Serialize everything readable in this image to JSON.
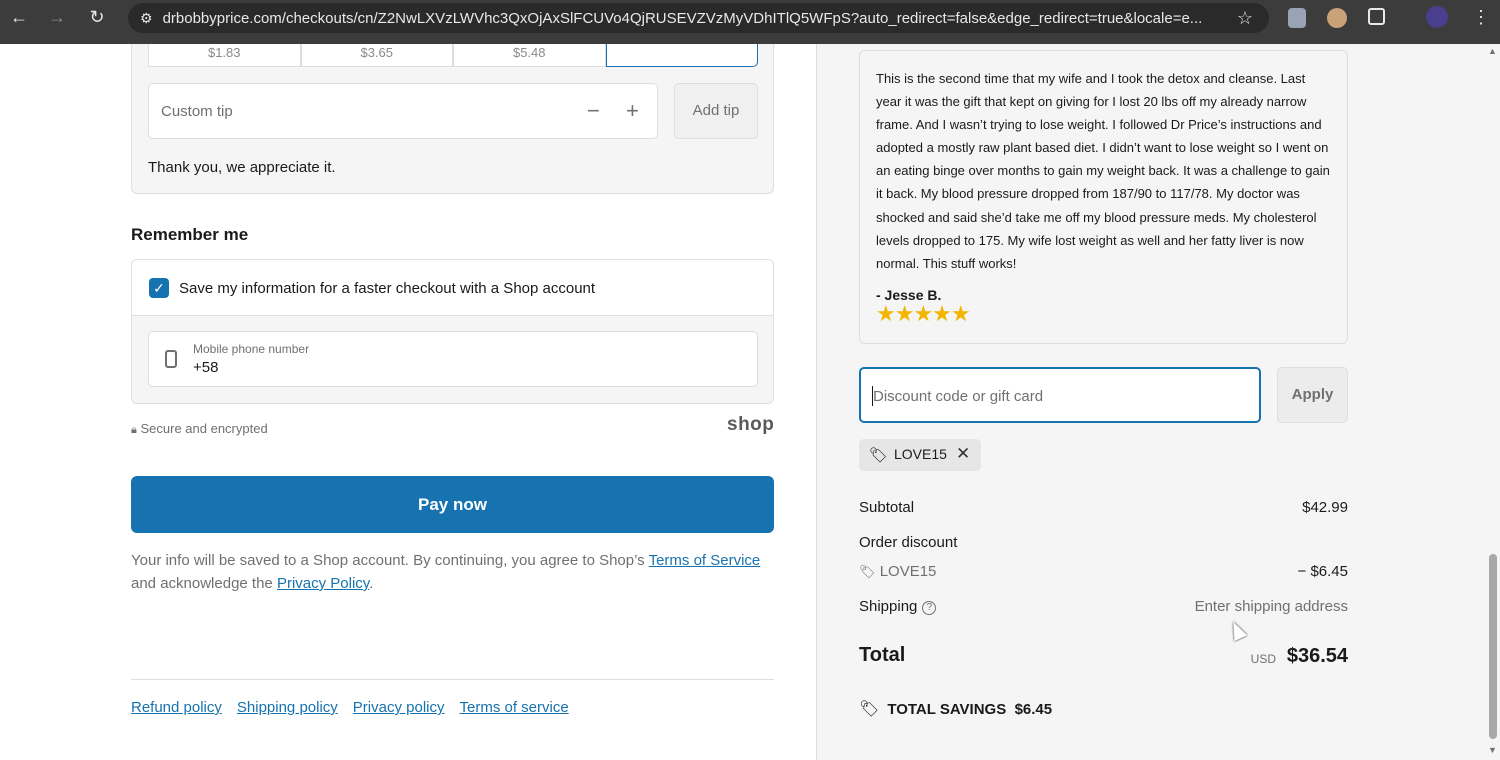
{
  "browser": {
    "url": "drbobbyprice.com/checkouts/cn/Z2NwLXVzLWVhc3QxOjAxSlFCUVo4QjRUSEVZVzMyVDhITlQ5WFpS?auto_redirect=false&edge_redirect=true&locale=e..."
  },
  "tip": {
    "options": [
      "$1.83",
      "$3.65",
      "$5.48",
      ""
    ],
    "custom_placeholder": "Custom tip",
    "minus": "−",
    "plus": "+",
    "add_label": "Add tip",
    "thanks": "Thank you, we appreciate it."
  },
  "remember": {
    "heading": "Remember me",
    "checkbox_label": "Save my information for a faster checkout with a Shop account",
    "phone_label": "Mobile phone number",
    "phone_value": "+58",
    "secure": "Secure and encrypted",
    "shop_logo": "shop"
  },
  "pay": {
    "button": "Pay now",
    "legal_1": "Your info will be saved to a Shop account. By continuing, you agree to Shop’s ",
    "terms_link": "Terms of Service",
    "legal_2": "and acknowledge the ",
    "privacy_link": "Privacy Policy",
    "legal_3": "."
  },
  "footer": {
    "links": [
      "Refund policy",
      "Shipping policy",
      "Privacy policy",
      "Terms of service"
    ]
  },
  "review": {
    "text": "This is the second time that my wife and I took the detox and cleanse. Last year it was the gift that kept on giving for I lost 20 lbs off my already narrow frame. And I wasn’t trying to lose weight. I followed Dr Price’s instructions and adopted a mostly raw plant based diet. I didn’t want to lose weight so I went on an eating binge over months to gain my weight back. It was a challenge to gain it back. My blood pressure dropped from 187/90 to 117/78. My doctor was shocked and said she’d take me off my blood pressure meds. My cholesterol levels dropped to 175. My wife lost weight as well and her fatty liver is now normal. This stuff works!",
    "author": "- Jesse B.",
    "stars": "★★★★★",
    "rating": 5
  },
  "discount": {
    "placeholder": "Discount code or gift card",
    "apply": "Apply",
    "applied_code": "LOVE15"
  },
  "summary": {
    "subtotal_label": "Subtotal",
    "subtotal_value": "$42.99",
    "order_discount_label": "Order discount",
    "discount_code": "LOVE15",
    "discount_value": "− $6.45",
    "shipping_label": "Shipping",
    "shipping_value": "Enter shipping address",
    "total_label": "Total",
    "currency": "USD",
    "total_value": "$36.54",
    "savings_label": "TOTAL SAVINGS",
    "savings_value": "$6.45"
  },
  "colors": {
    "accent": "#1773b0",
    "star": "#f2b600"
  }
}
